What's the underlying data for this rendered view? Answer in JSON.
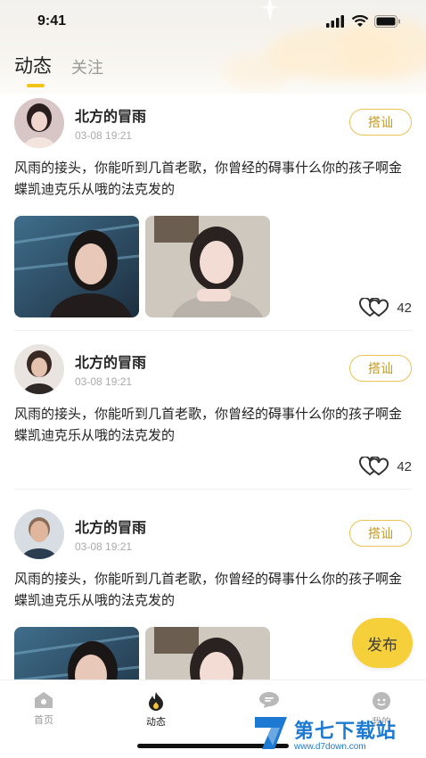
{
  "status_bar": {
    "time": "9:41"
  },
  "tabs": [
    {
      "label": "动态",
      "active": true
    },
    {
      "label": "关注",
      "active": false
    }
  ],
  "posts": [
    {
      "username": "北方的冒雨",
      "time": "03-08 19:21",
      "action_label": "搭讪",
      "text": "风雨的接头，你能听到几首老歌，你曾经的碍事什么你的孩子啊金蝶凯迪克乐从哦的法克发的",
      "likes": "42",
      "has_photos": true
    },
    {
      "username": "北方的冒雨",
      "time": "03-08 19:21",
      "action_label": "搭讪",
      "text": "风雨的接头，你能听到几首老歌，你曾经的碍事什么你的孩子啊金蝶凯迪克乐从哦的法克发的",
      "likes": "42",
      "has_photos": false
    },
    {
      "username": "北方的冒雨",
      "time": "03-08 19:21",
      "action_label": "搭讪",
      "text": "风雨的接头，你能听到几首老歌，你曾经的碍事什么你的孩子啊金蝶凯迪克乐从哦的法克发的",
      "likes": "",
      "has_photos": true
    }
  ],
  "publish_label": "发布",
  "bottom_nav": [
    {
      "label": "首页",
      "icon": "home-icon",
      "active": false
    },
    {
      "label": "动态",
      "icon": "flame-icon",
      "active": true
    },
    {
      "label": "",
      "icon": "message-icon",
      "active": false
    },
    {
      "label": "我的",
      "icon": "profile-icon",
      "active": false
    }
  ],
  "watermark": {
    "title": "第七下载站",
    "url": "www.d7down.com"
  },
  "colors": {
    "accent": "#f5d03a",
    "chat_border": "#eac256",
    "watermark": "#1d7ad2"
  }
}
